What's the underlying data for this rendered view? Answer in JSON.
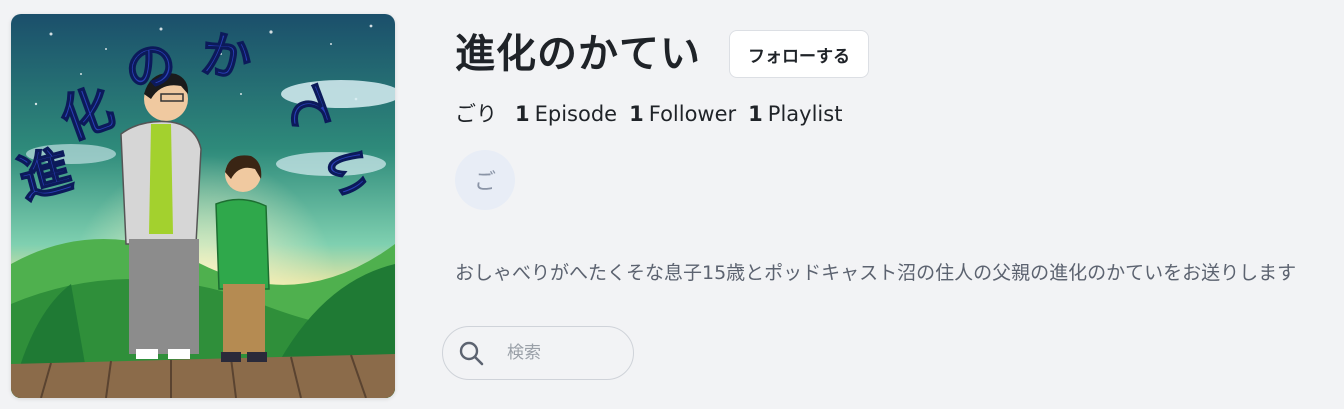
{
  "podcast": {
    "title": "進化のかてい",
    "follow_label": "フォローする",
    "author": "ごり",
    "stats": {
      "episodes_count": "1",
      "episodes_label": "Episode",
      "followers_count": "1",
      "followers_label": "Follower",
      "playlists_count": "1",
      "playlists_label": "Playlist"
    },
    "avatar_initial": "ご",
    "description": "おしゃべりがへたくそな息子15歳とポッドキャスト沼の住人の父親の進化のかていをお送りします",
    "artwork_lettering": [
      "進",
      "化",
      "の",
      "か",
      "て",
      "い"
    ]
  },
  "search": {
    "placeholder": "検索",
    "value": ""
  },
  "colors": {
    "background": "#f2f3f5",
    "artwork_letter_blue": "#2a3fb8"
  },
  "icons": {
    "search": "magnifier"
  }
}
